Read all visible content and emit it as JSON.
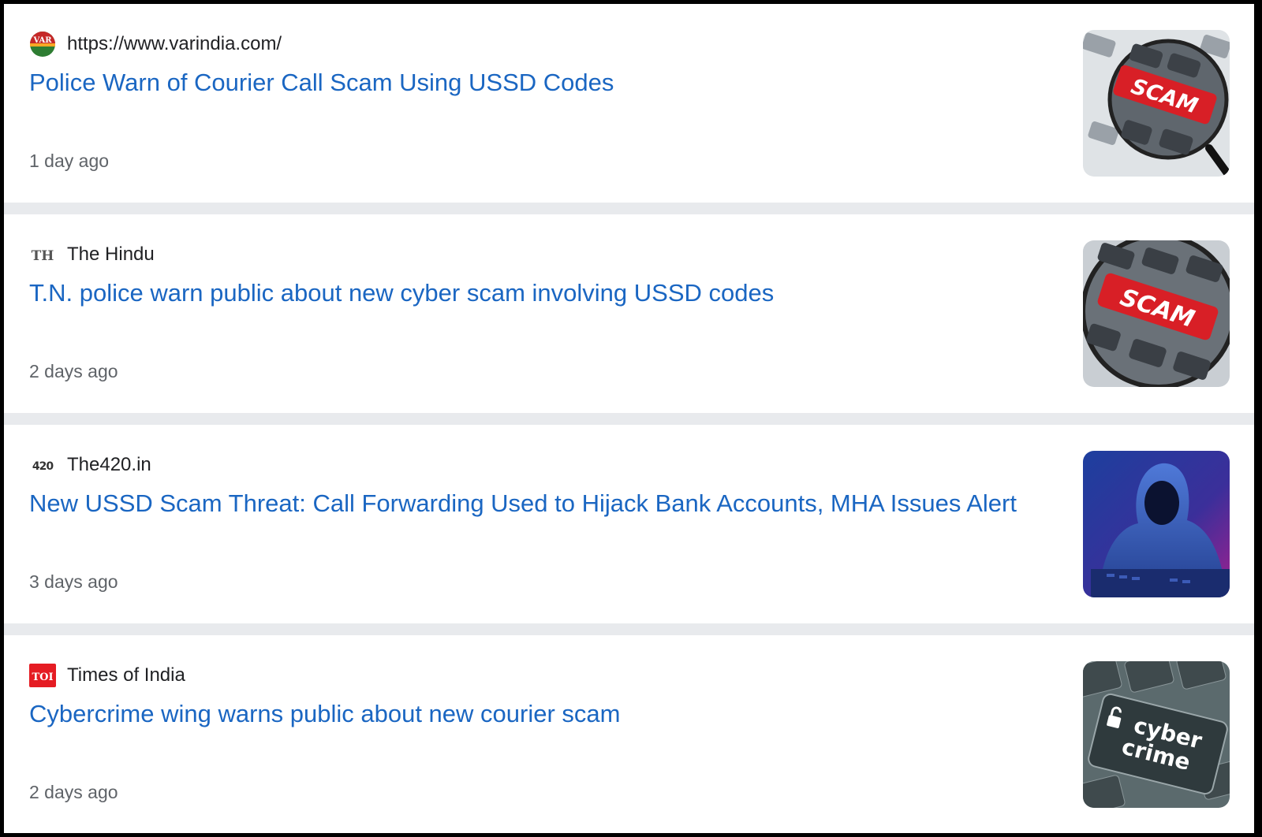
{
  "results": [
    {
      "source": "https://www.varindia.com/",
      "favicon": "varindia-logo-icon",
      "favicon_text": "VAR",
      "title": "Police Warn of Courier Call Scam Using USSD Codes",
      "age": "1 day ago",
      "thumbnail": "scam-key-magnifier-image",
      "thumb_text": "SCAM"
    },
    {
      "source": "The Hindu",
      "favicon": "the-hindu-logo-icon",
      "favicon_text": "TH",
      "title": "T.N. police warn public about new cyber scam involving USSD codes",
      "age": "2 days ago",
      "thumbnail": "scam-key-magnifier-image",
      "thumb_text": "SCAM"
    },
    {
      "source": "The420.in",
      "favicon": "the420-logo-icon",
      "favicon_text": "420",
      "title": "New USSD Scam Threat: Call Forwarding Used to Hijack Bank Accounts, MHA Issues Alert",
      "age": "3 days ago",
      "thumbnail": "hooded-hacker-image"
    },
    {
      "source": "Times of India",
      "favicon": "times-of-india-logo-icon",
      "favicon_text": "TOI",
      "title": "Cybercrime wing warns public about new courier scam",
      "age": "2 days ago",
      "thumbnail": "cyber-crime-keyboard-image",
      "thumb_text_1": "cyber",
      "thumb_text_2": "crime"
    }
  ],
  "colors": {
    "headline_link": "#1a66c2",
    "source_text": "#202124",
    "age_text": "#5f6368",
    "separator": "#e8eaed",
    "scam_key_red": "#d81f26",
    "toi_red": "#e51c23"
  }
}
